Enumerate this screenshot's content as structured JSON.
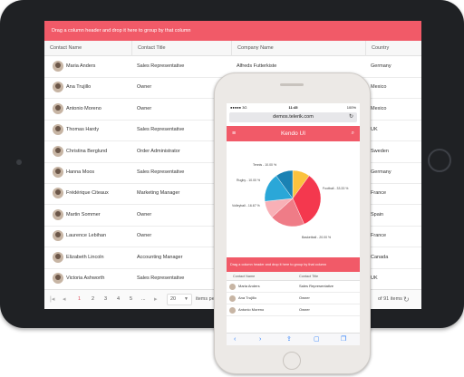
{
  "tablet": {
    "group_hint": "Drag a column header and drop it here to group by that column",
    "columns": [
      "Contact Name",
      "Contact Title",
      "Company Name",
      "Country"
    ],
    "rows": [
      {
        "name": "Maria Anders",
        "title": "Sales Representative",
        "company": "Alfreds Futterkiste",
        "country": "Germany"
      },
      {
        "name": "Ana Trujillo",
        "title": "Owner",
        "company": "",
        "country": "Mexico"
      },
      {
        "name": "Antonio Moreno",
        "title": "Owner",
        "company": "",
        "country": "Mexico"
      },
      {
        "name": "Thomas Hardy",
        "title": "Sales Representative",
        "company": "",
        "country": "UK"
      },
      {
        "name": "Christina Berglund",
        "title": "Order Administrator",
        "company": "",
        "country": "Sweden"
      },
      {
        "name": "Hanna Moos",
        "title": "Sales Representative",
        "company": "",
        "country": "Germany"
      },
      {
        "name": "Frédérique Citeaux",
        "title": "Marketing Manager",
        "company": "",
        "country": "France"
      },
      {
        "name": "Martin Sommer",
        "title": "Owner",
        "company": "",
        "country": "Spain"
      },
      {
        "name": "Laurence Lebihan",
        "title": "Owner",
        "company": "",
        "country": "France"
      },
      {
        "name": "Elizabeth Lincoln",
        "title": "Accounting Manager",
        "company": "",
        "country": "Canada"
      },
      {
        "name": "Victoria Ashworth",
        "title": "Sales Representative",
        "company": "",
        "country": "UK"
      }
    ],
    "pager": {
      "first": "|◂",
      "prev": "◂",
      "pages": [
        "1",
        "2",
        "3",
        "4",
        "5"
      ],
      "ellipsis": "...",
      "next": "▸",
      "last": "▸|",
      "page_size": "20",
      "page_size_label": "items per",
      "info": "of 91 items",
      "refresh": "↻"
    }
  },
  "phone": {
    "status_left": "●●●●● 3G",
    "time": "11:45",
    "battery": "100%",
    "url": "demos.telerik.com",
    "reload": "↻",
    "header_title": "Kendo UI",
    "menu_icon": "≡",
    "search_icon": "⌕",
    "group_hint": "Drag a column header and drop it here to group by that column",
    "columns": [
      "Contact Name",
      "Contact Title"
    ],
    "rows": [
      {
        "name": "Maria Anders",
        "title": "Sales Representative"
      },
      {
        "name": "Ana Trujillo",
        "title": "Owner"
      },
      {
        "name": "Antonio Moreno",
        "title": "Owner"
      }
    ],
    "toolbar": [
      "‹",
      "›",
      "⇪",
      "▢",
      "❐"
    ]
  },
  "colors": {
    "accent": "#f15a68",
    "pie": [
      "#fbc23e",
      "#f4384e",
      "#ef7c87",
      "#f8b0b6",
      "#2aa7d8",
      "#1a82b4"
    ]
  },
  "chart_data": {
    "type": "pie",
    "labels": [
      "Tennis - 10.00 %",
      "Football - 33.33 %",
      "Basketball - 20.00 %",
      "",
      "Volleyball - 16.67 %",
      "Rugby - 10.00 %"
    ],
    "values": [
      10.0,
      33.33,
      20.0,
      10.0,
      16.67,
      10.0
    ]
  }
}
